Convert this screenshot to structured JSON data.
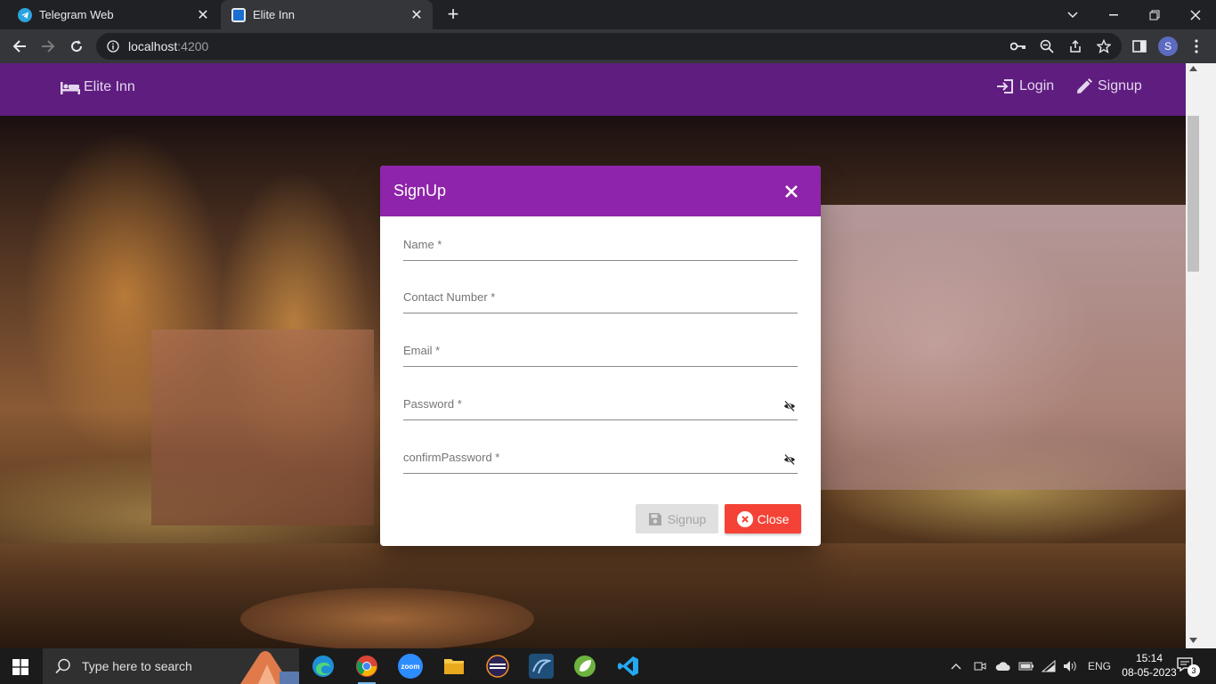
{
  "browser": {
    "tabs": [
      {
        "title": "Telegram Web",
        "icon": "telegram-icon",
        "active": false
      },
      {
        "title": "Elite Inn",
        "icon": "elite-inn-favicon",
        "active": true
      }
    ],
    "url_host": "localhost",
    "url_port": ":4200",
    "profile_initial": "S"
  },
  "navbar": {
    "brand": "Elite Inn",
    "login_label": "Login",
    "signup_label": "Signup",
    "bg_color": "#5e1d7f"
  },
  "dialog": {
    "title": "SignUp",
    "header_color": "#8e24aa",
    "fields": {
      "name": "Name *",
      "contact": "Contact Number *",
      "email": "Email *",
      "password": "Password *",
      "confirm_password": "confirmPassword *"
    },
    "signup_button": "Signup",
    "signup_disabled": true,
    "close_button": "Close",
    "close_color": "#f44336"
  },
  "taskbar": {
    "search_placeholder": "Type here to search",
    "language": "ENG",
    "time": "15:14",
    "date": "08-05-2023",
    "notifications": "3"
  }
}
